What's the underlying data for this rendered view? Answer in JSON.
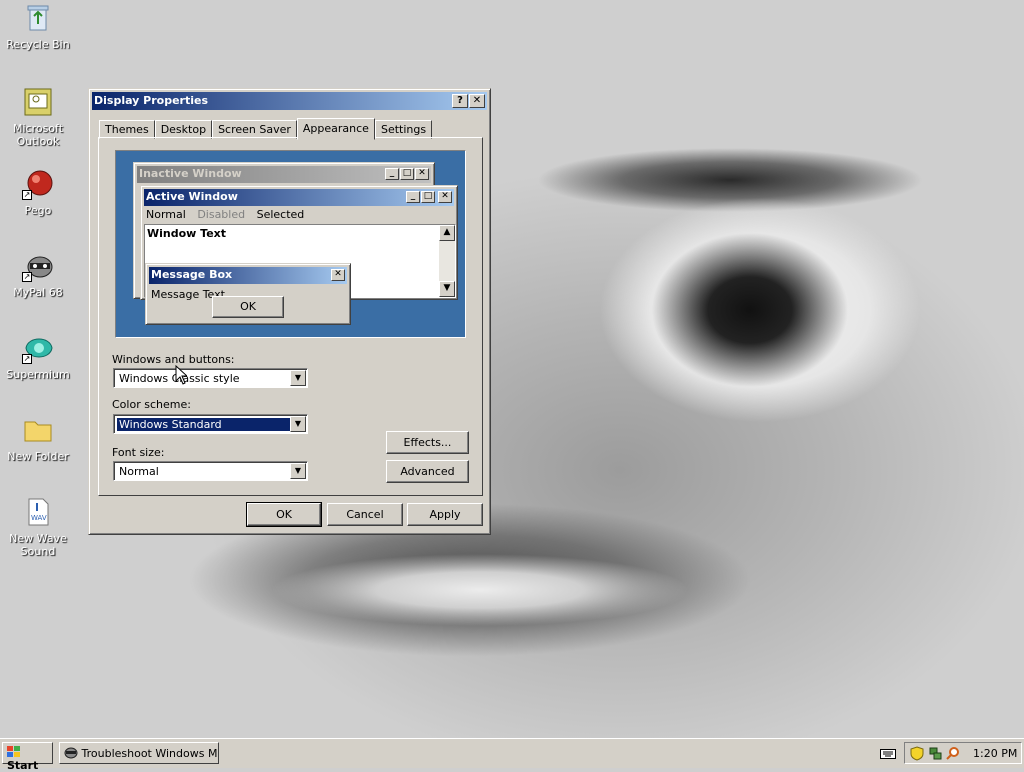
{
  "desktop": {
    "icons": [
      {
        "label": "Recycle Bin"
      },
      {
        "label": "Microsoft Outlook"
      },
      {
        "label": "Pego"
      },
      {
        "label": "MyPal 68"
      },
      {
        "label": "Supermium"
      },
      {
        "label": "New Folder"
      },
      {
        "label": "New Wave Sound"
      }
    ]
  },
  "dialog": {
    "title": "Display Properties",
    "help_btn": "?",
    "close_btn": "✕",
    "tabs": [
      "Themes",
      "Desktop",
      "Screen Saver",
      "Appearance",
      "Settings"
    ],
    "active_tab": "Appearance",
    "preview": {
      "inactive_title": "Inactive Window",
      "active_title": "Active Window",
      "menu": [
        "Normal",
        "Disabled",
        "Selected"
      ],
      "window_text": "Window Text",
      "msgbox_title": "Message Box",
      "msgbox_text": "Message Text",
      "msgbox_ok": "OK"
    },
    "windows_buttons_label": "Windows and buttons:",
    "windows_buttons_value": "Windows Classic style",
    "color_scheme_label": "Color scheme:",
    "color_scheme_value": "Windows Standard",
    "font_size_label": "Font size:",
    "font_size_value": "Normal",
    "effects_btn": "Effects...",
    "advanced_btn": "Advanced",
    "ok_btn": "OK",
    "cancel_btn": "Cancel",
    "apply_btn": "Apply"
  },
  "taskbar": {
    "start": "Start",
    "task": "Troubleshoot Windows M...",
    "clock": "1:20 PM"
  }
}
